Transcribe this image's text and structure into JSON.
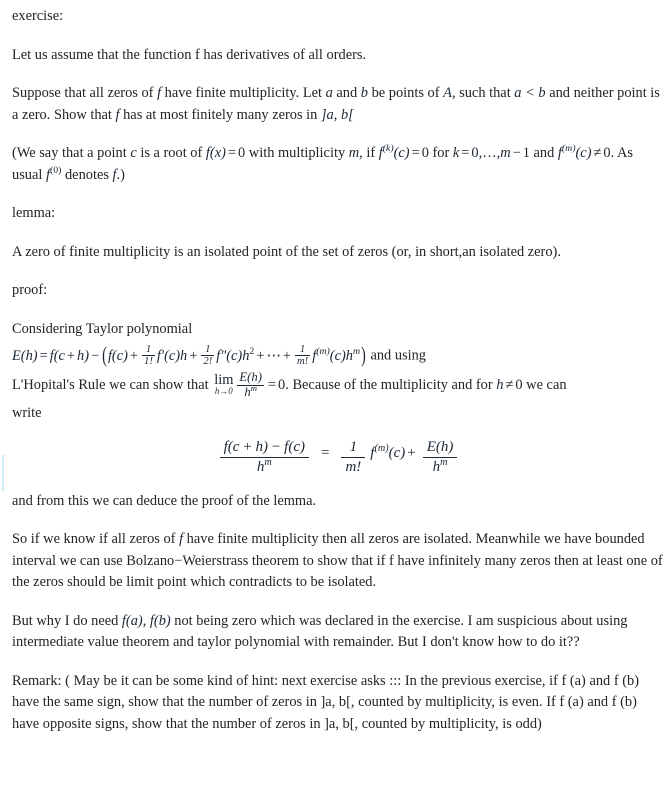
{
  "document": {
    "type": "math-qa-post",
    "background_color": "#ffffff",
    "text_color": "#222426",
    "math_color": "#1b2733",
    "marker_color": "#cfe8f5"
  },
  "sections": {
    "exercise_label": "exercise:",
    "assume_line": "Let us assume that the function f has derivatives of all orders.",
    "suppose": {
      "part1": "Suppose that all zeros of ",
      "f": "f",
      "part2": " have finite multiplicity. Let ",
      "a": "a",
      "part3": " and ",
      "b": "b",
      "part4": " be points of ",
      "A": "A",
      "part5": ", such that ",
      "alessb": "a < b",
      "part6": " and neither point is a zero. Show that ",
      "f2": "f",
      "part7": " has at most finitely many zeros in ",
      "interval": "]a, b["
    },
    "parenthetical": {
      "part1": "(We say that a point ",
      "c": "c",
      "part2": " is a root of ",
      "fx0": "f(x) = 0",
      "part3": " with multiplicity ",
      "m": "m",
      "part4": ", if ",
      "fkc0": "f^(k)(c) = 0",
      "part5": " for ",
      "krange": "k = 0, … , m − 1",
      "part6": " and ",
      "fmc": "f^(m)(c) ≠ 0",
      "part7": ". As usual ",
      "f0": "f^(0)",
      "part8": " denotes ",
      "fdot": "f",
      "part9": ".)"
    },
    "lemma_label": "lemma:",
    "lemma_text": "A zero of finite multiplicity is an isolated point of the set of zeros (or, in short,an isolated zero).",
    "proof_label": "proof:",
    "considering": "Considering Taylor polynomial",
    "taylor": {
      "lhs": "E(h)",
      "eq": "=",
      "fch": "f(c + h)",
      "minus": "−",
      "fc": "f(c)",
      "plus": "+",
      "coef1_num": "1",
      "coef1_den": "1!",
      "term1": "f′(c)h",
      "coef2_num": "1",
      "coef2_den": "2!",
      "term2": "f″(c)h",
      "term2_exp": "2",
      "dots": "⋯",
      "coefm_num": "1",
      "coefm_den": "m!",
      "termm": "f",
      "termm_sup": "(m)",
      "termm_rest": "(c)h",
      "termm_exp": "m",
      "trailing_text": "and using"
    },
    "lhopital": {
      "part1": "L'Hopital's Rule we can show that ",
      "lim": "lim",
      "limsub": "h→0",
      "frac_num": "E(h)",
      "frac_den": "h^m",
      "equals_zero": "= 0",
      "part2": ". Because of the multiplicity and for ",
      "hne0": "h ≠ 0",
      "part3": " we can"
    },
    "write_label": "write",
    "display_equation": {
      "lhs_num": "f(c + h) − f(c)",
      "lhs_den": "h^m",
      "eq": "=",
      "rhs_coef_num": "1",
      "rhs_coef_den": "m!",
      "rhs_term": "f^(m)(c)",
      "plus": "+",
      "rhs_frac_num": "E(h)",
      "rhs_frac_den": "h^m"
    },
    "deduce": "and from this we can deduce the proof of the lemma.",
    "so_if": {
      "part1": "So if we know if all zeros of ",
      "f": "f",
      "part2": " have finite multiplicity then all zeros are isolated. Meanwhile we have bounded interval we can use Bolzano−Weierstrass theorem to show that if f have infinitely many zeros then at least one of the zeros should be limit point which contradicts to be isolated."
    },
    "but_why": {
      "part1": "But why I do need ",
      "fa": "f(a)",
      "comma": ", ",
      "fb": "f(b)",
      "part2": " not being zero which was declared in the exercise. I am suspicious about using intermediate value theorem and taylor polynomial with remainder. But I don't know how to do it??"
    },
    "remark": "Remark: ( May be it can be some kind of hint: next exercise asks ::: In the previous exercise, if f (a) and f (b) have the same sign, show that the number of zeros in ]a, b[, counted by multiplicity, is even. If f (a) and f (b) have opposite signs, show that the number of zeros in ]a, b[, counted by multiplicity, is odd)"
  }
}
